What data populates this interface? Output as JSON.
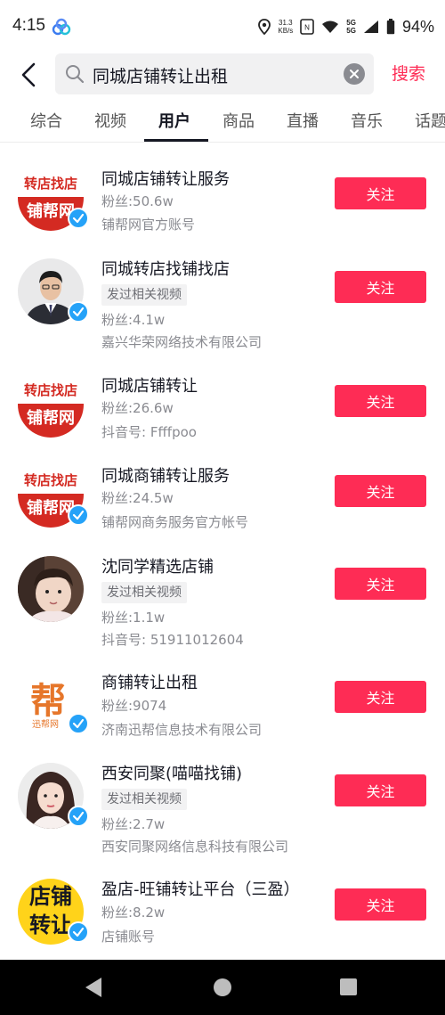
{
  "status_bar": {
    "time": "4:15",
    "net_speed_value": "31.3",
    "net_speed_unit": "KB/s",
    "sim_label_1": "5G",
    "sim_label_2": "5G",
    "battery": "94%"
  },
  "search": {
    "query": "同城店铺转让出租",
    "submit_label": "搜索"
  },
  "tabs": [
    {
      "label": "综合"
    },
    {
      "label": "视频"
    },
    {
      "label": "用户"
    },
    {
      "label": "商品"
    },
    {
      "label": "直播"
    },
    {
      "label": "音乐"
    },
    {
      "label": "话题"
    }
  ],
  "active_tab": "用户",
  "users": [
    {
      "name": "同城店铺转让服务",
      "tag": "",
      "fans": "粉丝:50.6w",
      "desc": "铺帮网官方账号",
      "verified": true,
      "avatar": "logo-red",
      "avatar_text_top": "转店找店",
      "avatar_text_bottom": "铺帮网",
      "follow": "关注"
    },
    {
      "name": "同城转店找铺找店",
      "tag": "发过相关视频",
      "fans": "粉丝:4.1w",
      "desc": "嘉兴华荣网络技术有限公司",
      "verified": true,
      "avatar": "photo-man",
      "follow": "关注"
    },
    {
      "name": "同城店铺转让",
      "tag": "",
      "fans": "粉丝:26.6w",
      "desc": "抖音号: Ffffpoo",
      "verified": false,
      "avatar": "logo-red",
      "avatar_text_top": "转店找店",
      "avatar_text_bottom": "铺帮网",
      "follow": "关注"
    },
    {
      "name": "同城商铺转让服务",
      "tag": "",
      "fans": "粉丝:24.5w",
      "desc": "铺帮网商务服务官方帐号",
      "verified": true,
      "avatar": "logo-red",
      "avatar_text_top": "转店找店",
      "avatar_text_bottom": "铺帮网",
      "follow": "关注"
    },
    {
      "name": "沈同学精选店铺",
      "tag": "发过相关视频",
      "fans": "粉丝:1.1w",
      "desc": "抖音号: 51911012604",
      "verified": false,
      "avatar": "photo-child",
      "follow": "关注"
    },
    {
      "name": "商铺转让出租",
      "tag": "",
      "fans": "粉丝:9074",
      "desc": "济南迅帮信息技术有限公司",
      "verified": true,
      "avatar": "logo-bang",
      "avatar_text_top": "帮",
      "avatar_text_bottom": "迅帮网",
      "follow": "关注"
    },
    {
      "name": "西安同聚(喵喵找铺)",
      "tag": "发过相关视频",
      "fans": "粉丝:2.7w",
      "desc": "西安同聚网络信息科技有限公司",
      "verified": true,
      "avatar": "photo-woman",
      "follow": "关注"
    },
    {
      "name": "盈店-旺铺转让平台（三盈）",
      "tag": "",
      "fans": "粉丝:8.2w",
      "desc": "店铺账号",
      "verified": true,
      "avatar": "logo-yellow",
      "avatar_text_top": "店铺转让",
      "follow": "关注"
    }
  ],
  "colors": {
    "accent": "#fe2c55",
    "verified": "#25a2f8",
    "logo_red": "#d42a22"
  }
}
